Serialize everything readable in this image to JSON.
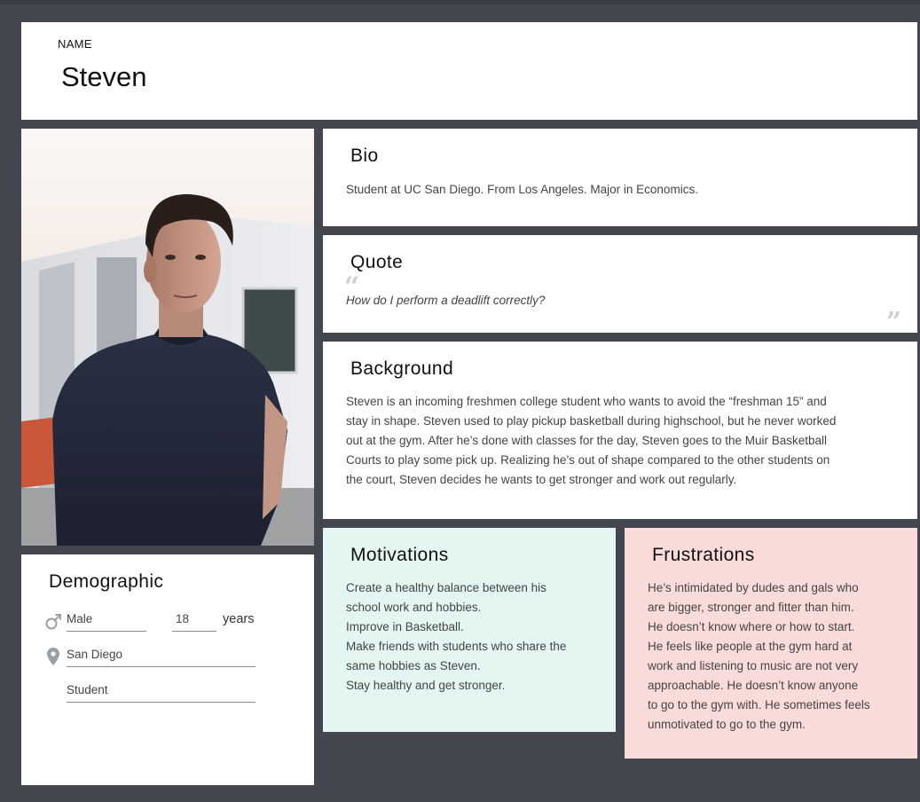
{
  "name_card": {
    "label": "NAME",
    "value": "Steven"
  },
  "photo": {
    "alt": "Portrait of Steven"
  },
  "bio": {
    "title": "Bio",
    "text": "Student at UC San Diego. From Los Angeles. Major in Economics."
  },
  "quote": {
    "title": "Quote",
    "open_mark": "“",
    "close_mark": "”",
    "text": "How do I perform a deadlift correctly?"
  },
  "background": {
    "title": "Background",
    "lines": [
      "Steven is an incoming freshmen college student who wants to avoid the “freshman 15” and",
      "stay in shape. Steven used to play pickup basketball during highschool, but he never worked",
      "out at the gym. After he’s done with classes for the day, Steven goes to the Muir Basketball",
      "Courts to play some pick up. Realizing he’s out of shape compared to the other students on",
      "the court, Steven decides he wants to get stronger and work out regularly."
    ]
  },
  "motivations": {
    "title": "Motivations",
    "lines": [
      "Create a healthy balance between his",
      "school work and hobbies.",
      "Improve in Basketball.",
      "Make friends with students who share the",
      "same hobbies as Steven.",
      "Stay healthy and get stronger."
    ],
    "bg_color": "#e3f6f2"
  },
  "frustrations": {
    "title": "Frustrations",
    "lines": [
      "He’s intimidated by dudes and gals who",
      "are bigger, stronger and fitter than him.",
      "He doesn’t know where or how to start.",
      "He feels like people at the gym hard at",
      "work and listening to music are not very",
      "approachable. He doesn’t know anyone",
      "to go to the gym with. He sometimes feels",
      "unmotivated to go to the gym."
    ],
    "bg_color": "#f9dcd9"
  },
  "demographic": {
    "title": "Demographic",
    "gender": "Male",
    "age": "18",
    "age_unit": "years",
    "location": "San Diego",
    "occupation": "Student",
    "icons": {
      "gender": "male-icon",
      "location": "map-pin-icon"
    }
  }
}
